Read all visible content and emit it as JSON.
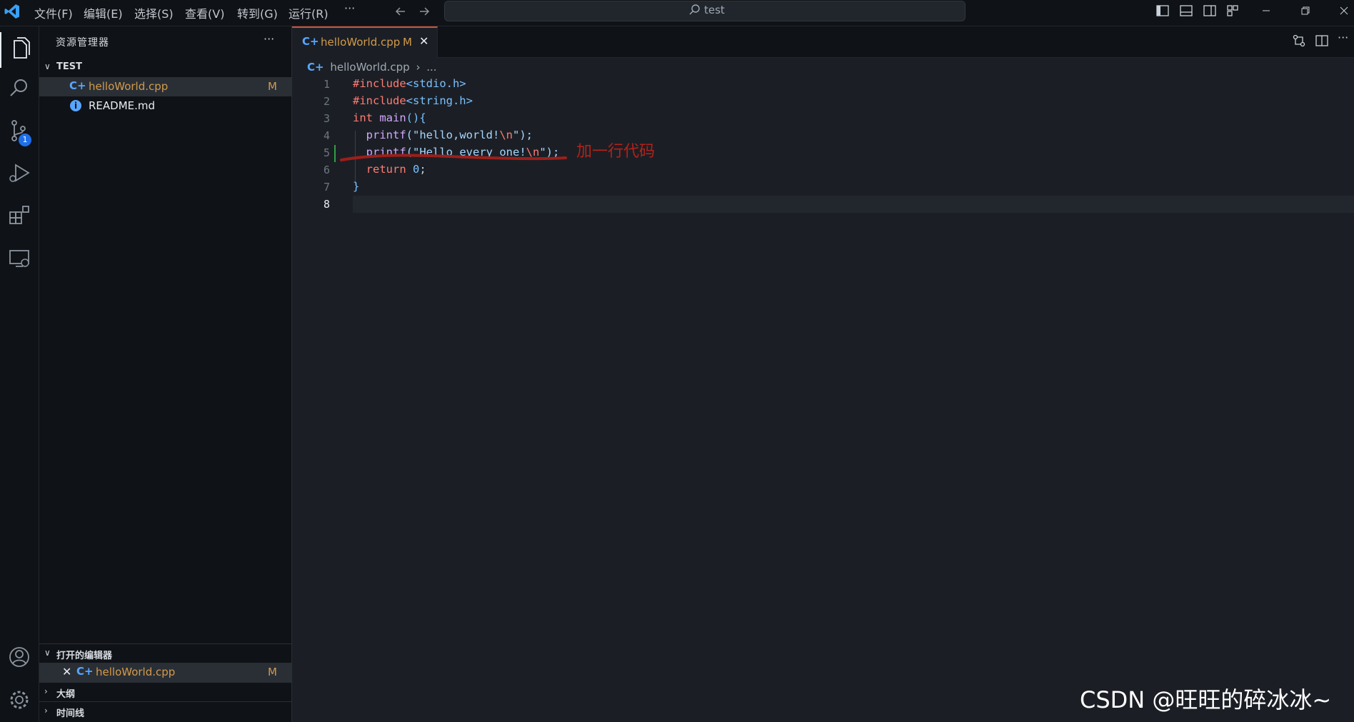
{
  "titlebar": {
    "menus": [
      "文件(F)",
      "编辑(E)",
      "选择(S)",
      "查看(V)",
      "转到(G)",
      "运行(R)",
      "···"
    ],
    "search_text": "test",
    "window_buttons": [
      "minimize",
      "restore",
      "close"
    ]
  },
  "activitybar": {
    "items": [
      "explorer-icon",
      "search-icon",
      "source-control-icon",
      "run-debug-icon",
      "extensions-icon",
      "remote-explorer-icon"
    ],
    "source_control_badge": "1",
    "bottom": [
      "account-icon",
      "settings-gear-icon"
    ]
  },
  "sidebar": {
    "title": "资源管理器",
    "more": "···",
    "folder": "TEST",
    "files": [
      {
        "name": "helloWorld.cpp",
        "badge": "M"
      },
      {
        "name": "README.md",
        "badge": ""
      }
    ],
    "open_editors": {
      "label": "打开的编辑器",
      "close": "✕",
      "file": "helloWorld.cpp",
      "badge": "M"
    },
    "outline_label": "大纲",
    "timeline_label": "时间线"
  },
  "editor": {
    "tab": {
      "name": "helloWorld.cpp",
      "badge": "M",
      "close": "✕"
    },
    "breadcrumb": {
      "file": "helloWorld.cpp",
      "more": "..."
    },
    "line_numbers": [
      "1",
      "2",
      "3",
      "4",
      "5",
      "6",
      "7",
      "8"
    ],
    "code": {
      "l1_kw": "#include",
      "l1_rest": "<stdio.h>",
      "l2_kw": "#include",
      "l2_rest": "<string.h>",
      "l3_type": "int",
      "l3_fn": "main",
      "l3_rest": "(){",
      "l4_fn": "printf",
      "l4_open": "(\"",
      "l4_str": "hello,world!",
      "l4_esc": "\\n",
      "l4_close": "\");",
      "l5_fn": "printf",
      "l5_open": "(\"",
      "l5_str": "Hello every one!",
      "l5_esc": "\\n",
      "l5_close": "\");",
      "l6_kw": "return",
      "l6_num": "0",
      "l6_rest": ";",
      "l7": "}"
    },
    "annotation": "加一行代码"
  },
  "watermark": "CSDN @旺旺的碎冰冰~",
  "colors": {
    "accent_tab": "#d0553a",
    "modified": "#d39a4a",
    "badge": "#1f6feb",
    "annotation": "#b4211a"
  }
}
